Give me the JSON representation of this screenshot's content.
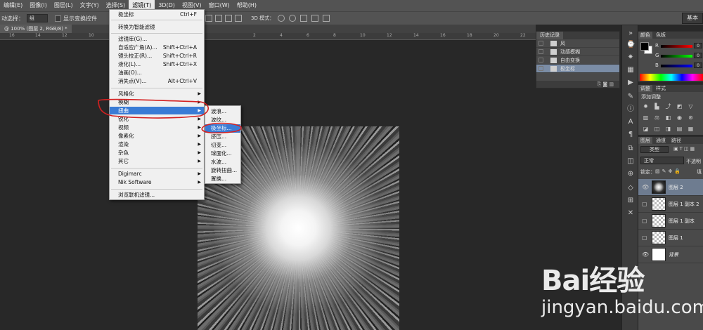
{
  "menubar": {
    "items": [
      "编辑(E)",
      "图像(I)",
      "图层(L)",
      "文字(Y)",
      "选择(S)",
      "滤镜(T)",
      "3D(D)",
      "视图(V)",
      "窗口(W)",
      "帮助(H)"
    ]
  },
  "options": {
    "auto_select_label": "动选择：",
    "auto_select_value": "组",
    "show_transform_label": "显示变换控件",
    "mode_3d_label": "3D 模式：",
    "workspace_label": "基本"
  },
  "document": {
    "tab_title": "@ 100% (图层 2, RGB/8) *",
    "ruler_numbers": [
      "16",
      "14",
      "12",
      "10",
      "8",
      "6",
      "4",
      "2",
      "0",
      "2",
      "4",
      "6",
      "8",
      "10",
      "12",
      "14",
      "16",
      "18",
      "20",
      "22",
      "24",
      "26"
    ]
  },
  "filter_menu": {
    "items": [
      {
        "label": "极坐标",
        "shortcut": "Ctrl+F"
      },
      {
        "label": "转换为智能滤镜",
        "shortcut": ""
      },
      {
        "label": "滤镜库(G)...",
        "shortcut": ""
      },
      {
        "label": "自适应广角(A)...",
        "shortcut": "Shift+Ctrl+A"
      },
      {
        "label": "镜头校正(R)...",
        "shortcut": "Shift+Ctrl+R"
      },
      {
        "label": "液化(L)...",
        "shortcut": "Shift+Ctrl+X"
      },
      {
        "label": "油画(O)...",
        "shortcut": ""
      },
      {
        "label": "消失点(V)...",
        "shortcut": "Alt+Ctrl+V"
      },
      {
        "label": "风格化",
        "shortcut": ""
      },
      {
        "label": "模糊",
        "shortcut": ""
      },
      {
        "label": "扭曲",
        "shortcut": ""
      },
      {
        "label": "锐化",
        "shortcut": ""
      },
      {
        "label": "视频",
        "shortcut": ""
      },
      {
        "label": "像素化",
        "shortcut": ""
      },
      {
        "label": "渲染",
        "shortcut": ""
      },
      {
        "label": "杂色",
        "shortcut": ""
      },
      {
        "label": "其它",
        "shortcut": ""
      },
      {
        "label": "Digimarc",
        "shortcut": ""
      },
      {
        "label": "Nik Software",
        "shortcut": ""
      },
      {
        "label": "浏览联机滤镜...",
        "shortcut": ""
      }
    ]
  },
  "distort_submenu": {
    "items": [
      "波浪...",
      "波纹...",
      "极坐标...",
      "挤压...",
      "切变...",
      "球面化...",
      "水波...",
      "旋转扭曲...",
      "置换..."
    ]
  },
  "history": {
    "tab_label": "历史记录",
    "items": [
      "风",
      "动感模糊",
      "自由变换",
      "极坐标"
    ]
  },
  "color_panel": {
    "tabs": [
      "颜色",
      "色板"
    ],
    "channels": [
      {
        "label": "R",
        "value": "0"
      },
      {
        "label": "G",
        "value": "0"
      },
      {
        "label": "B",
        "value": "0"
      }
    ],
    "colors": {
      "foreground": "#000000",
      "background": "#ffffff"
    }
  },
  "adjust_panel": {
    "tabs": [
      "调整",
      "样式"
    ],
    "add_label": "添加调整"
  },
  "layers_panel": {
    "tabs": [
      "图层",
      "通道",
      "路径"
    ],
    "kind_label": "类型",
    "blend_mode": "正常",
    "opacity_label": "不透明",
    "lock_label": "锁定：",
    "fill_label": "填",
    "layers": [
      {
        "name": "图层 2",
        "visible": true,
        "selected": true
      },
      {
        "name": "图层 1 副本 2",
        "visible": false,
        "selected": false
      },
      {
        "name": "图层 1 副本",
        "visible": false,
        "selected": false
      },
      {
        "name": "图层 1",
        "visible": false,
        "selected": false
      },
      {
        "name": "背景",
        "visible": true,
        "selected": false
      }
    ]
  },
  "watermark": {
    "logo": "Bai经验",
    "url": "jingyan.baidu.com"
  }
}
